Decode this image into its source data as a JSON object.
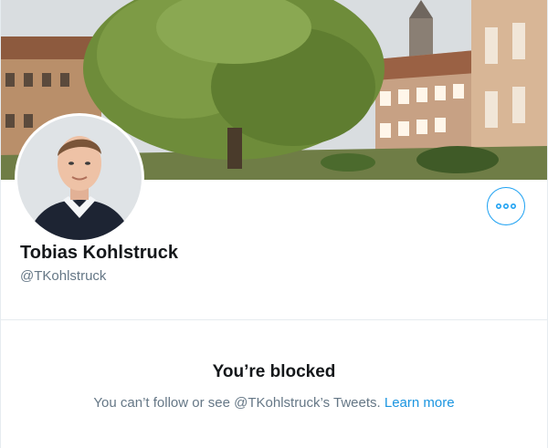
{
  "profile": {
    "display_name": "Tobias Kohlstruck",
    "handle": "@TKohlstruck"
  },
  "actions": {
    "more_icon": "more-horizontal-icon"
  },
  "blocked": {
    "title": "You’re blocked",
    "message": "You can’t follow or see @TKohlstruck’s Tweets.",
    "link_label": "Learn more"
  },
  "colors": {
    "accent": "#1da1f2",
    "link": "#1b95e0",
    "secondary_text": "#657786",
    "divider": "#e6ecf0"
  }
}
